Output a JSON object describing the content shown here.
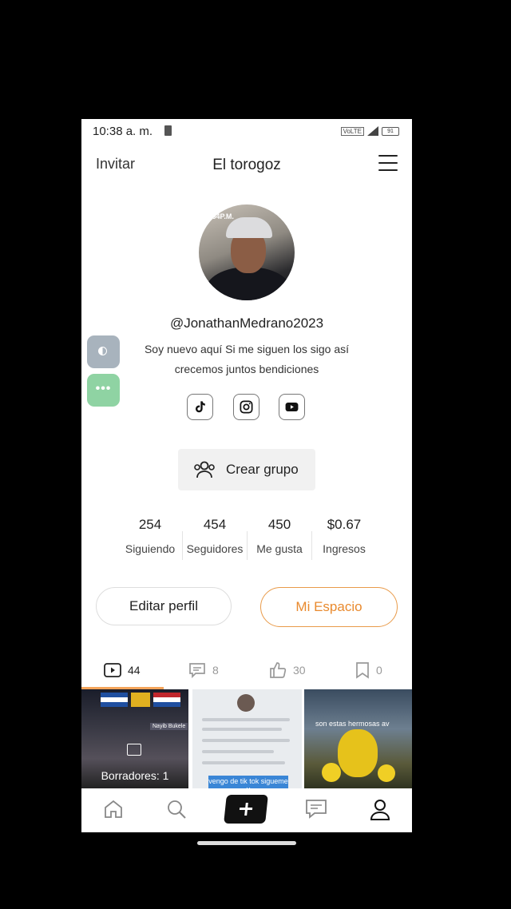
{
  "status_bar": {
    "time": "10:38 a. m.",
    "battery": "91"
  },
  "header": {
    "invite_label": "Invitar",
    "title": "El torogoz"
  },
  "profile": {
    "avatar_stamp": ".54P.M.",
    "handle": "@JonathanMedrano2023",
    "bio": "Soy nuevo aquí Si me siguen los sigo así crecemos juntos bendiciones"
  },
  "socials": [
    "tiktok-icon",
    "instagram-icon",
    "youtube-icon"
  ],
  "create_group_label": "Crear grupo",
  "stats": [
    {
      "value": "254",
      "label": "Siguiendo"
    },
    {
      "value": "454",
      "label": "Seguidores"
    },
    {
      "value": "450",
      "label": "Me gusta"
    },
    {
      "value": "$0.67",
      "label": "Ingresos"
    }
  ],
  "buttons": {
    "edit_profile": "Editar perfil",
    "my_space": "Mi Espacio"
  },
  "tabs": [
    {
      "icon": "video-icon",
      "count": "44"
    },
    {
      "icon": "comment-icon",
      "count": "8"
    },
    {
      "icon": "like-icon",
      "count": "30"
    },
    {
      "icon": "bookmark-icon",
      "count": "0"
    }
  ],
  "grid": {
    "drafts_label": "Borradores: 1",
    "item2_caption": "vengo de tik tok sigueme y",
    "item3_caption": "son estas hermosas av"
  },
  "colors": {
    "accent": "#e98a2e",
    "tab_underline": "#f4a45a"
  }
}
